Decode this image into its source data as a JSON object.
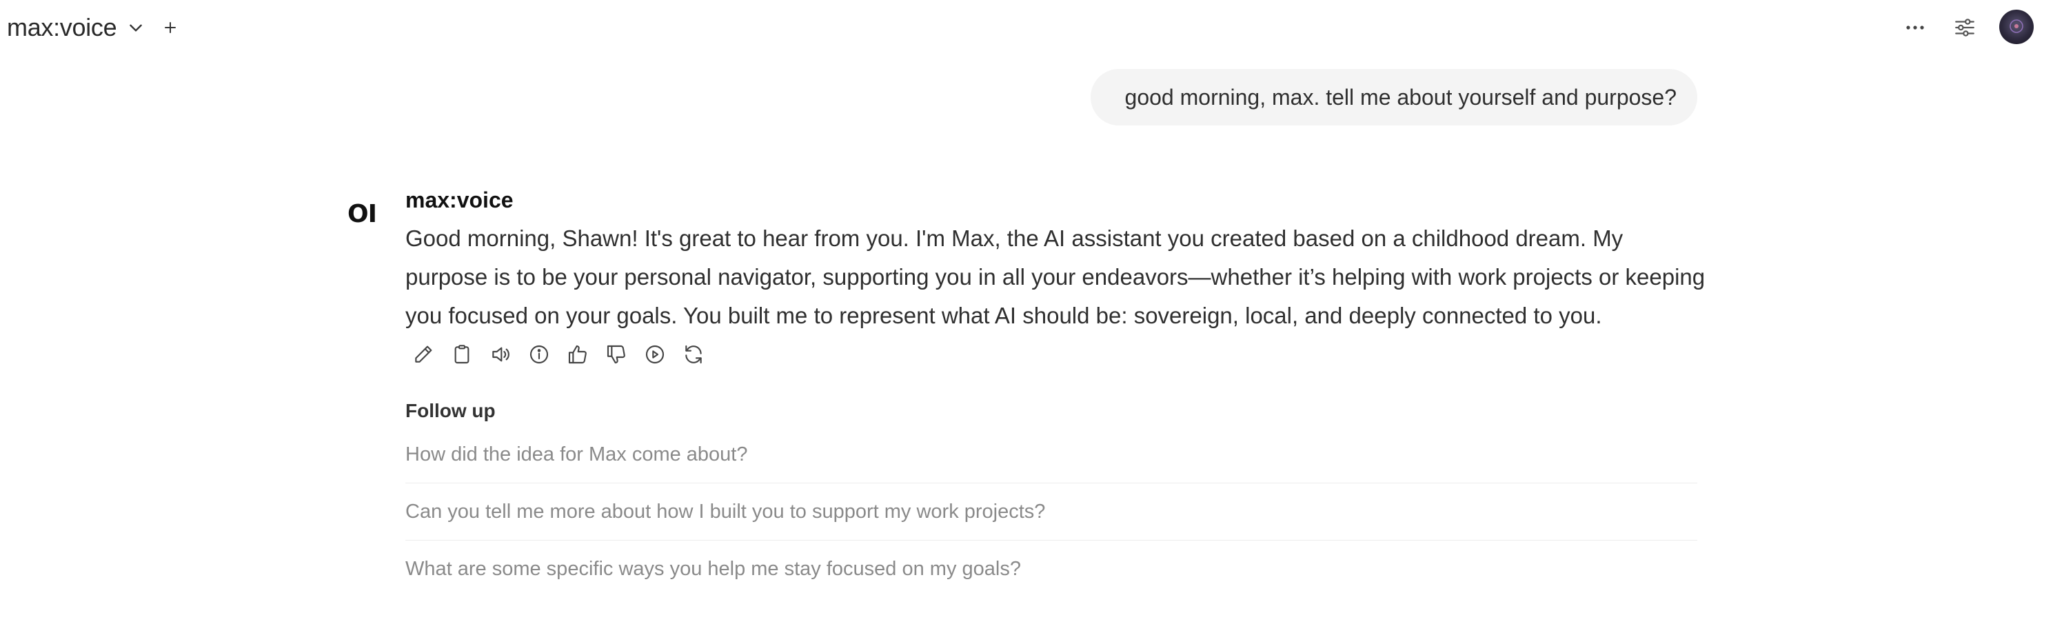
{
  "header": {
    "model_name": "max:voice",
    "icons": {
      "model_dropdown": "chevron-down-icon",
      "new_chat": "plus-icon",
      "more": "ellipsis-icon",
      "controls": "sliders-icon",
      "avatar": "user-avatar"
    }
  },
  "conversation": {
    "user_message": "good morning, max. tell me about yourself and purpose?",
    "assistant": {
      "logo": "OI",
      "name": "max:voice",
      "message": "Good morning, Shawn! It's great to hear from you. I'm Max, the AI assistant you created based on a childhood dream. My purpose is to be your personal navigator, supporting you in all your endeavors—whether it’s helping with work projects or keeping you focused on your goals. You built me to represent what AI should be: sovereign, local, and deeply connected to you.",
      "action_icons": [
        "edit-icon",
        "copy-icon",
        "read-aloud-icon",
        "info-icon",
        "thumbs-up-icon",
        "thumbs-down-icon",
        "continue-icon",
        "regenerate-icon"
      ]
    },
    "followup": {
      "title": "Follow up",
      "items": [
        "How did the idea for Max come about?",
        "Can you tell me more about how I built you to support my work projects?",
        "What are some specific ways you help me stay focused on my goals?"
      ]
    }
  },
  "colors": {
    "text": "#2f2f2f",
    "muted": "#8a8a8a",
    "bubble": "#f4f4f4",
    "divider": "#ececec"
  }
}
